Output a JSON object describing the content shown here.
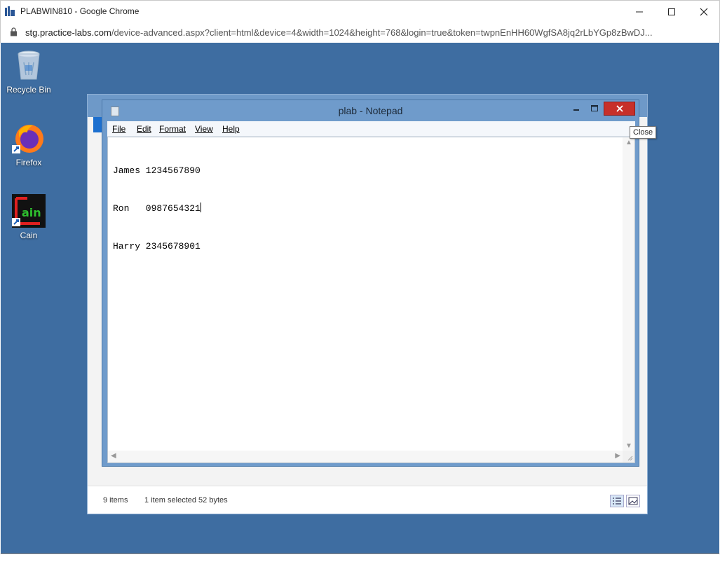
{
  "chrome": {
    "title": "PLABWIN810 - Google Chrome",
    "url_host": "stg.practice-labs.com",
    "url_path": "/device-advanced.aspx?client=html&device=4&width=1024&height=768&login=true&token=twpnEnHH60WgfSA8jq2rLbYGp8zBwDJ..."
  },
  "desktop_icons": [
    {
      "label": "Recycle Bin",
      "icon": "recycle-bin-icon"
    },
    {
      "label": "Firefox",
      "icon": "firefox-icon"
    },
    {
      "label": "Cain",
      "icon": "cain-icon"
    }
  ],
  "explorer": {
    "items_count": "9 items",
    "selection": "1 item selected  52 bytes"
  },
  "notepad": {
    "title": "plab - Notepad",
    "menu": [
      "File",
      "Edit",
      "Format",
      "View",
      "Help"
    ],
    "lines": [
      "James 1234567890",
      "Ron   0987654321",
      "Harry 2345678901"
    ]
  },
  "tooltip": "Close",
  "colors": {
    "desktop": "#3e6da1",
    "taskbar": "#2a4e7a",
    "close_button": "#c7302a"
  }
}
